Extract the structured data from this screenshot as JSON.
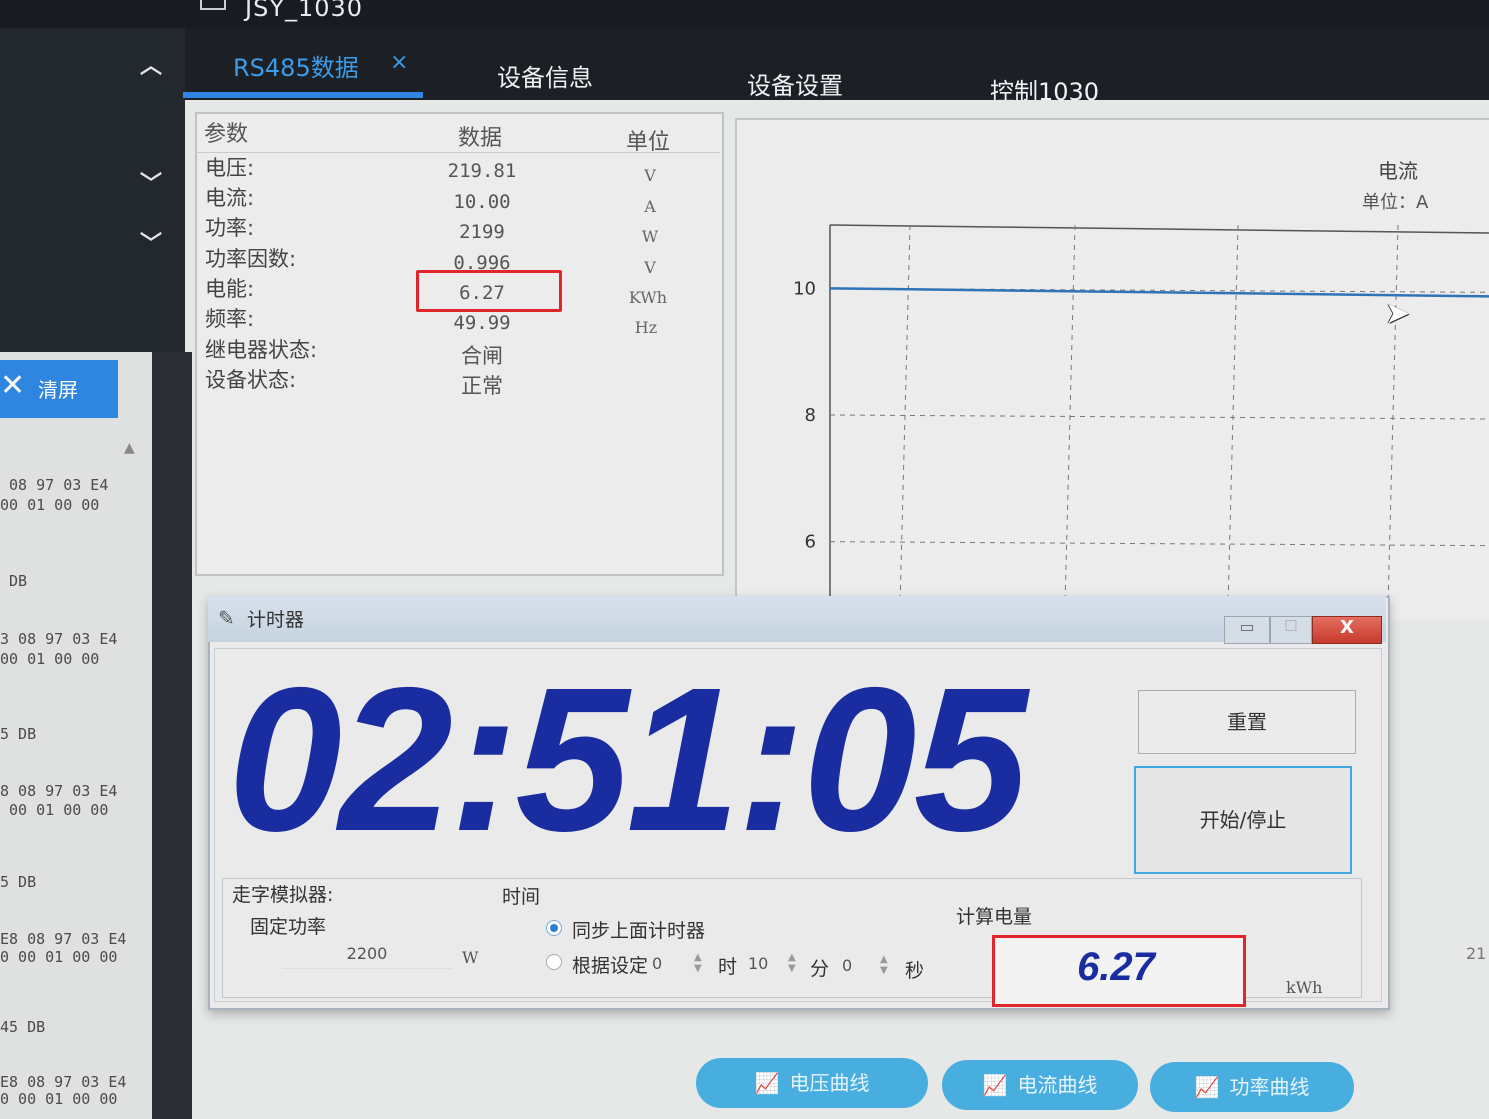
{
  "window": {
    "title": "JSY_1030"
  },
  "tabs": [
    {
      "label": "RS485数据",
      "active": true,
      "close": "×"
    },
    {
      "label": "设备信息"
    },
    {
      "label": "设备设置"
    },
    {
      "label": "控制1030"
    }
  ],
  "log": {
    "clear_label": "清屏",
    "lines": [
      " 08 97 03 E4",
      "00 01 00 00",
      " DB",
      "3 08 97 03 E4",
      "00 01 00 00",
      "5 DB",
      "8 08 97 03 E4",
      " 00 01 00 00",
      "5 DB",
      "E8 08 97 03 E4",
      "0 00 01 00 00",
      "45 DB",
      "E8 08 97 03 E4",
      "0 00 01 00 00"
    ]
  },
  "data_table": {
    "headers": [
      "参数",
      "数据",
      "单位"
    ],
    "rows": [
      {
        "name": "电压:",
        "value": "219.81",
        "unit": "V"
      },
      {
        "name": "电流:",
        "value": "10.00",
        "unit": "A"
      },
      {
        "name": "功率:",
        "value": "2199",
        "unit": "W"
      },
      {
        "name": "功率因数:",
        "value": "0.996",
        "unit": "V"
      },
      {
        "name": "电能:",
        "value": "6.27",
        "unit": "KWh"
      },
      {
        "name": "频率:",
        "value": "49.99",
        "unit": "Hz"
      },
      {
        "name": "继电器状态:",
        "value": "合闸",
        "unit": ""
      },
      {
        "name": "设备状态:",
        "value": "正常",
        "unit": ""
      }
    ]
  },
  "chart_data": {
    "type": "line",
    "title": "电流",
    "unit_label": "单位：A",
    "yticks": [
      "10",
      "8",
      "6"
    ],
    "ylim": [
      5,
      11
    ],
    "grid": true,
    "series": [
      {
        "values": [
          10,
          10
        ]
      }
    ],
    "color": "#2f73b8",
    "partial_tick": "21"
  },
  "timer": {
    "title": "计时器",
    "display": "02:51:05",
    "reset_label": "重置",
    "startstop_label": "开始/停止",
    "simulator_label": "走字模拟器:",
    "fixed_power_label": "固定功率",
    "power_value": "2200",
    "power_unit": "W",
    "time_label": "时间",
    "sync_label": "同步上面计时器",
    "by_setting_label": "根据设定",
    "hours": "0",
    "hours_unit": "时",
    "minutes": "10",
    "minutes_unit": "分",
    "seconds": "0",
    "seconds_unit": "秒",
    "calc_label": "计算电量",
    "calc_value": "6.27",
    "calc_unit": "kWh",
    "close_glyph": "X"
  },
  "curve_buttons": [
    {
      "label": "电压曲线"
    },
    {
      "label": "电流曲线"
    },
    {
      "label": "功率曲线"
    }
  ],
  "colors": {
    "accent": "#2f86e0",
    "highlight": "#e0262b",
    "timer_digits": "#1a2da0",
    "curve_button": "#48aedf"
  }
}
